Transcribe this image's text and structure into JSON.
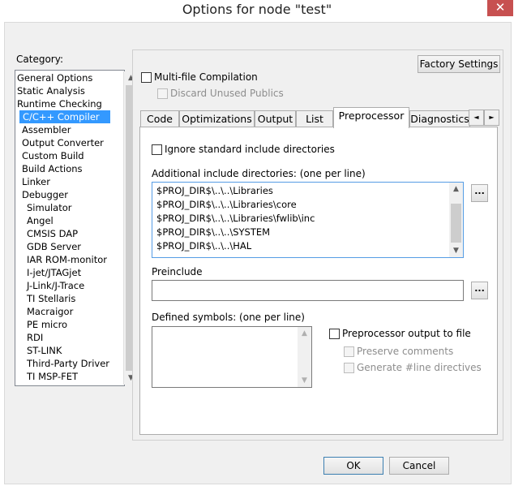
{
  "window": {
    "title": "Options for node \"test\"",
    "close_glyph": "✕"
  },
  "category": {
    "label": "Category:",
    "items": [
      {
        "label": "General Options",
        "level": 0
      },
      {
        "label": "Static Analysis",
        "level": 0
      },
      {
        "label": "Runtime Checking",
        "level": 0
      },
      {
        "label": "C/C++ Compiler",
        "level": 1,
        "selected": true
      },
      {
        "label": "Assembler",
        "level": 1
      },
      {
        "label": "Output Converter",
        "level": 1
      },
      {
        "label": "Custom Build",
        "level": 1
      },
      {
        "label": "Build Actions",
        "level": 1
      },
      {
        "label": "Linker",
        "level": 1
      },
      {
        "label": "Debugger",
        "level": 1
      },
      {
        "label": "Simulator",
        "level": 2
      },
      {
        "label": "Angel",
        "level": 2
      },
      {
        "label": "CMSIS DAP",
        "level": 2
      },
      {
        "label": "GDB Server",
        "level": 2
      },
      {
        "label": "IAR ROM-monitor",
        "level": 2
      },
      {
        "label": "I-jet/JTAGjet",
        "level": 2
      },
      {
        "label": "J-Link/J-Trace",
        "level": 2
      },
      {
        "label": "TI Stellaris",
        "level": 2
      },
      {
        "label": "Macraigor",
        "level": 2
      },
      {
        "label": "PE micro",
        "level": 2
      },
      {
        "label": "RDI",
        "level": 2
      },
      {
        "label": "ST-LINK",
        "level": 2
      },
      {
        "label": "Third-Party Driver",
        "level": 2
      },
      {
        "label": "TI MSP-FET",
        "level": 2
      }
    ]
  },
  "top": {
    "factory_settings": "Factory Settings",
    "multifile": "Multi-file Compilation",
    "discard": "Discard Unused Publics"
  },
  "tabs": [
    "Code",
    "Optimizations",
    "Output",
    "List",
    "Preprocessor",
    "Diagnostics"
  ],
  "tab_nav": {
    "left": "◄",
    "right": "►"
  },
  "preprocessor": {
    "ignore_std": "Ignore standard include directories",
    "include_label": "Additional include directories: (one per line)",
    "include_lines": [
      "$PROJ_DIR$\\..\\..\\Libraries",
      "$PROJ_DIR$\\..\\..\\Libraries\\core",
      "$PROJ_DIR$\\..\\..\\Libraries\\fwlib\\inc",
      "$PROJ_DIR$\\..\\..\\SYSTEM",
      "$PROJ_DIR$\\..\\..\\HAL"
    ],
    "preinclude_label": "Preinclude",
    "preinclude_value": "",
    "defined_label": "Defined symbols: (one per line)",
    "pp_output": "Preprocessor output to file",
    "preserve_comments": "Preserve comments",
    "generate_line": "Generate #line directives",
    "ellipsis": "..."
  },
  "footer": {
    "ok": "OK",
    "cancel": "Cancel"
  }
}
